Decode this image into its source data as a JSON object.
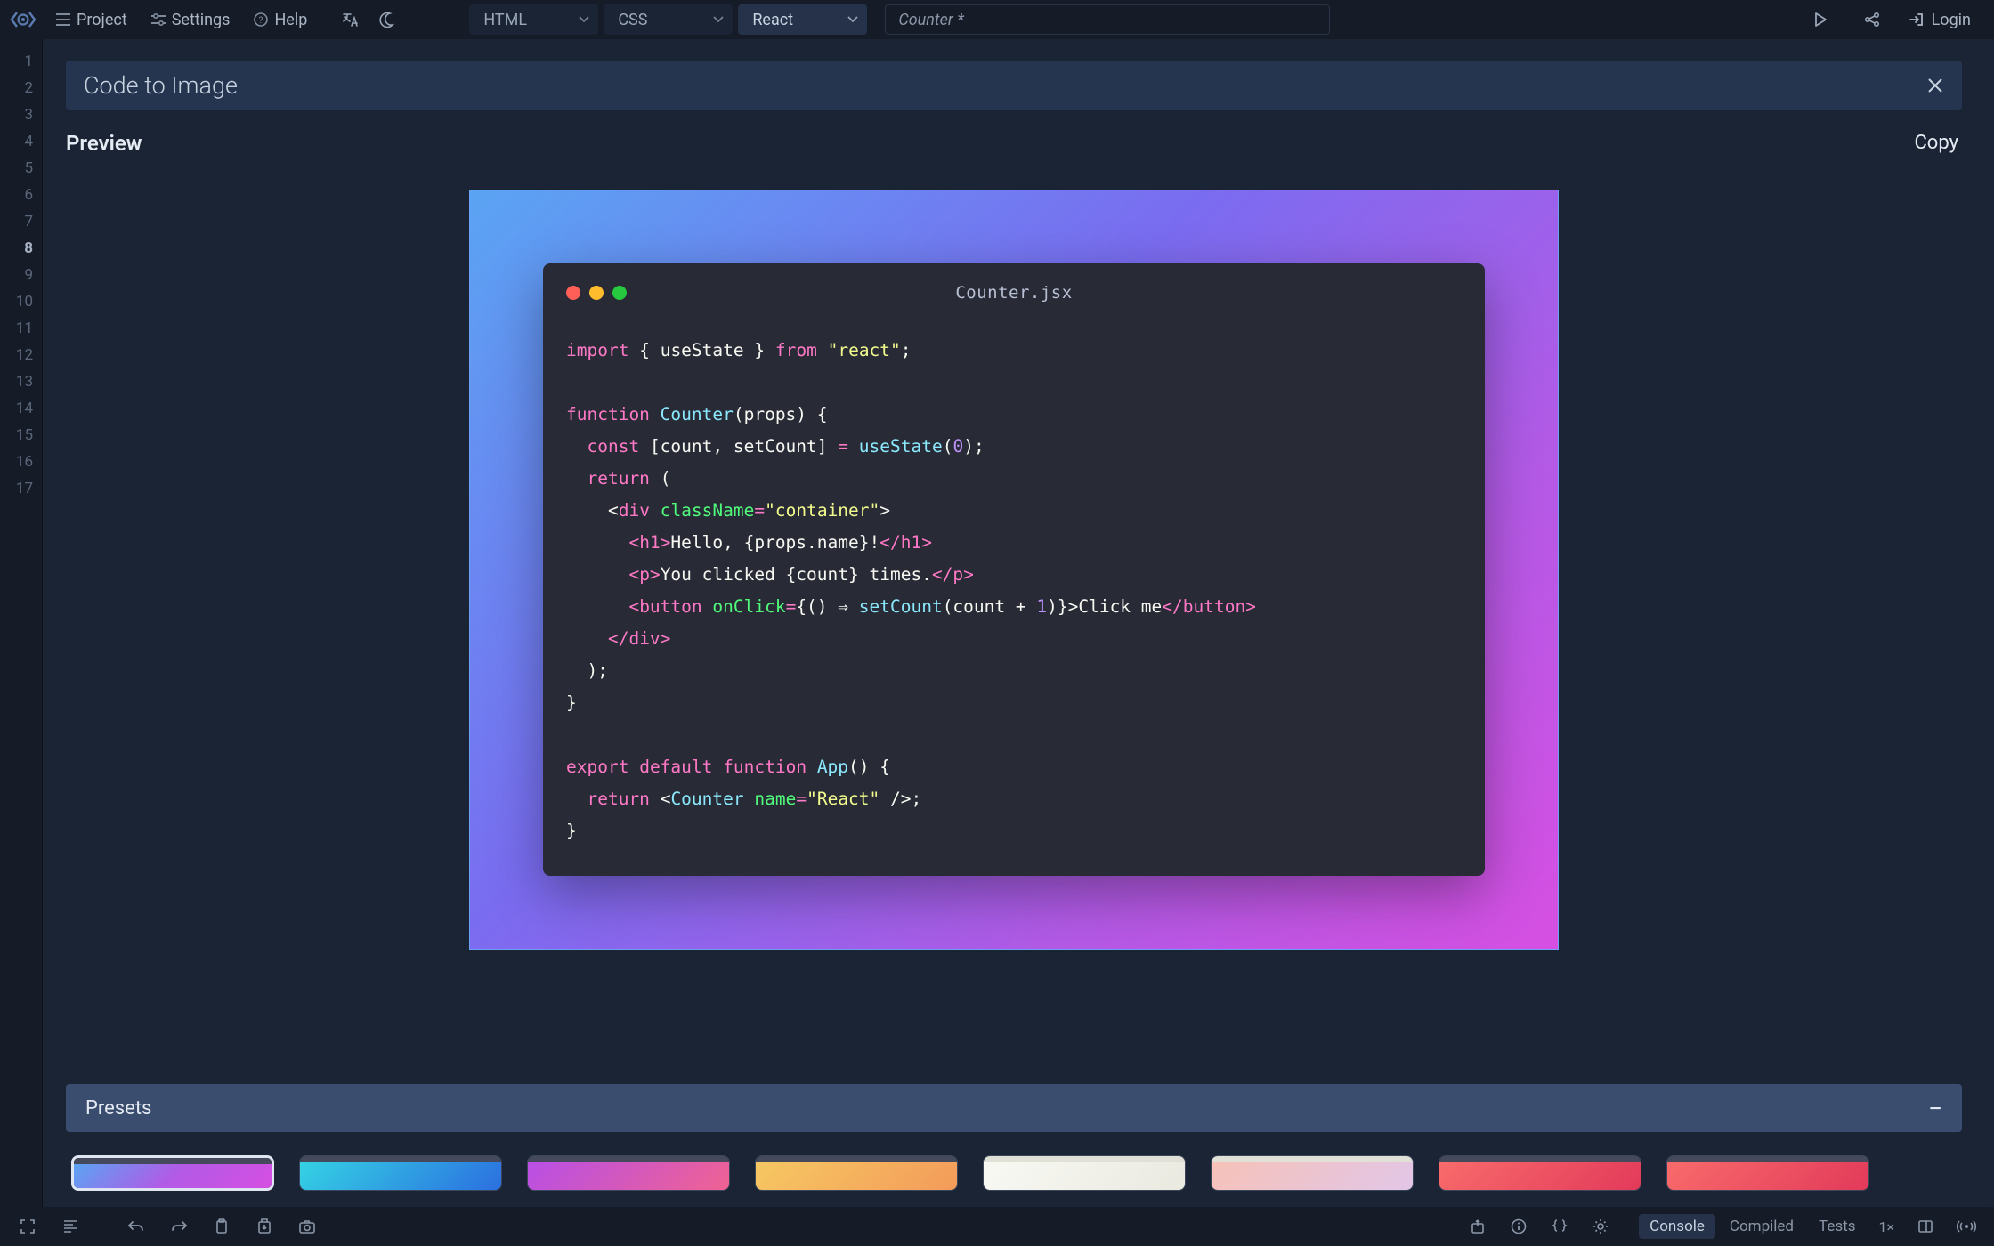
{
  "topbar": {
    "menu": {
      "project": "Project",
      "settings": "Settings",
      "help": "Help"
    },
    "tabs": [
      {
        "label": "HTML",
        "active": false
      },
      {
        "label": "CSS",
        "active": false
      },
      {
        "label": "React",
        "active": true
      }
    ],
    "url": {
      "value": "Counter *"
    },
    "login": "Login"
  },
  "gutter_lines": [
    "1",
    "2",
    "3",
    "4",
    "5",
    "6",
    "7",
    "8",
    "9",
    "10",
    "11",
    "12",
    "13",
    "14",
    "15",
    "16",
    "17"
  ],
  "gutter_bold_index": 7,
  "modal": {
    "title": "Code to Image",
    "preview_label": "Preview",
    "copy_label": "Copy",
    "presets_label": "Presets"
  },
  "card": {
    "filename": "Counter.jsx"
  },
  "code": {
    "l1": {
      "import": "import",
      "lb": "{",
      "useState": "useState",
      "rb": "}",
      "from": "from",
      "react": "\"react\"",
      "sc": ";"
    },
    "l3": {
      "function": "function",
      "name": "Counter",
      "sig": "(props) {"
    },
    "l4": {
      "const": "const",
      "destr": "[count, setCount]",
      "eq": "=",
      "useState": "useState",
      "arg": "(",
      "zero": "0",
      "close": ");"
    },
    "l5": {
      "return": "return",
      "open": "("
    },
    "l6": {
      "lt": "<",
      "div": "div",
      "cls": "className",
      "eq": "=",
      "val": "\"container\"",
      "gt": ">"
    },
    "l7": {
      "open": "<h1>",
      "text": "Hello, {props.name}!",
      "close": "</h1>"
    },
    "l8": {
      "open": "<p>",
      "text": "You clicked {count} times.",
      "close": "</p>"
    },
    "l9": {
      "open": "<button ",
      "onc": "onClick",
      "eq": "=",
      "cb": "{() ⇒ ",
      "sc_fn": "setCount",
      "args": "(count + ",
      "one": "1",
      "close_args": ")}",
      "gt": ">",
      "text": "Click me",
      "close": "</button>"
    },
    "l10": {
      "close": "</div>"
    },
    "l11": {
      "close": ");"
    },
    "l12": {
      "brace": "}"
    },
    "l14": {
      "export": "export",
      "default": "default",
      "function": "function",
      "name": "App",
      "sig": "() {"
    },
    "l15": {
      "return": "return",
      "lt": "<",
      "comp": "Counter",
      "attr": "name",
      "eq": "=",
      "val": "\"React\"",
      "end": " />;"
    },
    "l16": {
      "brace": "}"
    }
  },
  "bottombar": {
    "tabs": {
      "console": "Console",
      "compiled": "Compiled",
      "tests": "Tests"
    },
    "zoom": "1×"
  },
  "icons": {
    "hamburger": "menu",
    "sliders": "sliders",
    "question": "question",
    "translate": "translate",
    "moon": "moon",
    "chevron_down": "chevron-down",
    "play": "play",
    "share": "share",
    "login": "login",
    "close": "close"
  }
}
